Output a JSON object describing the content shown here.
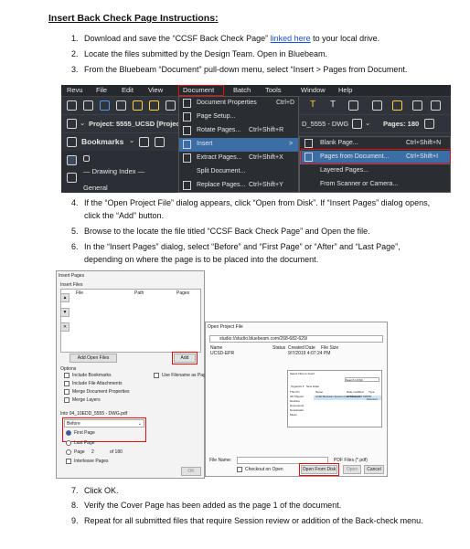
{
  "title": "Insert Back Check Page Instructions",
  "title_suffix": ":",
  "steps_a": [
    {
      "num": "1.",
      "pre": "Download and save the “CCSF Back Check Page” ",
      "link": "linked here",
      "post": " to your local drive."
    },
    {
      "num": "2.",
      "text": "Locate the files submitted by the Design Team. Open in Bluebeam."
    },
    {
      "num": "3.",
      "text": "From the Bluebeam “Document” pull-down menu, select “Insert > Pages from Document."
    }
  ],
  "steps_b": [
    {
      "num": "4.",
      "line1": "If the “Open Project File” dialog appears, click “Open from Disk”. If “Insert Pages” dialog opens,",
      "line2": "click the “Add” button."
    },
    {
      "num": "5.",
      "line1": "Browse to the locate the file titled “CCSF Back Check Page” and Open the file."
    },
    {
      "num": "6.",
      "line1": "In the “Insert Pages” dialog, select “Before” and “First Page” or “After” and “Last Page”,",
      "line2": "depending on where the page is to be placed into the document."
    }
  ],
  "steps_c": [
    {
      "num": "7.",
      "text": "Click OK."
    },
    {
      "num": "8.",
      "text": "Verify the Cover Page has been added as the page 1 of the document."
    },
    {
      "num": "9.",
      "text": "Repeat for all submitted files that require Session review or addition of the Back-check menu."
    }
  ],
  "bluebeam": {
    "menu": [
      "Revu",
      "File",
      "Edit",
      "View",
      "Document",
      "Batch",
      "Tools",
      "Window",
      "Help"
    ],
    "project": "Project: 5555_UCSD [Project I",
    "bookmarks": "Bookmarks",
    "drawing_index": "— Drawing Index —",
    "general": "General",
    "doc_name": "D_5555 - DWG",
    "pages": "Pages: 180",
    "doc_menu": [
      {
        "label": "Document Properties",
        "shortcut": "Ctrl+D"
      },
      {
        "label": "Page Setup...",
        "shortcut": ""
      },
      {
        "label": "Rotate Pages...",
        "shortcut": "Ctrl+Shift+R"
      },
      {
        "label": "Insert",
        "shortcut": ">"
      },
      {
        "label": "Extract Pages...",
        "shortcut": "Ctrl+Shift+X"
      },
      {
        "label": "Split Document...",
        "shortcut": ""
      },
      {
        "label": "Replace Pages...",
        "shortcut": "Ctrl+Shift+Y"
      }
    ],
    "sub_menu": [
      {
        "label": "Blank Page...",
        "shortcut": "Ctrl+Shift+N"
      },
      {
        "label": "Pages from Document...",
        "shortcut": "Ctrl+Shift+I"
      },
      {
        "label": "Layered Pages...",
        "shortcut": ""
      },
      {
        "label": "From Scanner or Camera...",
        "shortcut": ""
      }
    ]
  },
  "insert_dialog": {
    "title": "Insert Pages",
    "files_label": "Insert Files",
    "cols": [
      "File",
      "Path",
      "Pages"
    ],
    "add_open": "Add Open Files",
    "add": "Add",
    "options": "Options",
    "opts": [
      "Include Bookmarks",
      "Include File Attachments",
      "Merge Document Properties",
      "Merge Layers"
    ],
    "use_filename": "Use Filename as Page",
    "into": "Into 04_10EDD_5555 - DWG.pdf",
    "position": "Before",
    "radios": [
      "First Page",
      "Last Page",
      "Page",
      "Interleave Pages"
    ],
    "page_num": "2",
    "page_of": "of 180",
    "ok": "OK"
  },
  "open_dialog": {
    "title": "Open Project File",
    "url": "studio://studio.bluebeam.com/268-682-629/",
    "cols": [
      "Name",
      "Status",
      "Created Date",
      "File Size"
    ],
    "row": {
      "name": "UCSD-EPR",
      "date": "9/7/2019 4:07:24 PM"
    },
    "filename_label": "File Name:",
    "filter": "PDF Files (*.pdf)",
    "checkout": "Checkout on Open",
    "open_disk": "Open From Disk",
    "open": "Open",
    "cancel": "Cancel"
  },
  "file_dialog": {
    "title": "Select Files to Insert",
    "search": "Search UCSD",
    "organize": "Organize ▾",
    "new_folder": "New folder",
    "nav": [
      "This PC",
      "3D Objects",
      "Desktop",
      "Documents",
      "Downloads",
      "Music"
    ],
    "cols": [
      "Name",
      "Date modified",
      "Type"
    ],
    "file": "UCSD Bluebeam Session Cover Sheet.pdf",
    "file_date": "3/29/2019 8:47 PM",
    "file_type": "PDF Document"
  }
}
